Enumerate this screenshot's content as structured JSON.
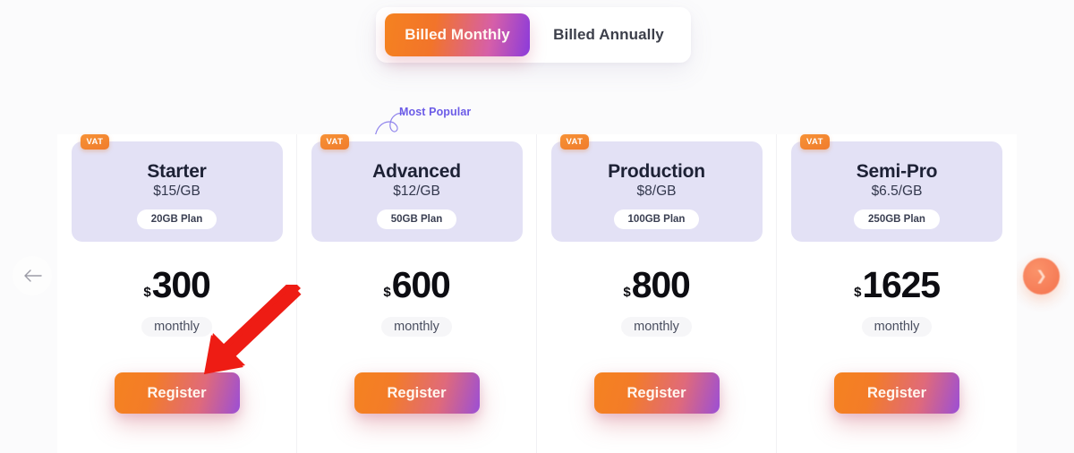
{
  "billing_toggle": {
    "monthly_label": "Billed Monthly",
    "annually_label": "Billed Annually",
    "active": "Billed Monthly",
    "active_gradient_from": "#f58220",
    "active_gradient_to": "#8b3bdb"
  },
  "annotations": {
    "most_popular_label": "Most Popular",
    "most_popular_color": "#6c5ce7",
    "pointer_arrow_color": "#ee1c14",
    "pointer_target": "Register"
  },
  "nav": {
    "prev_icon": "arrow-left-icon",
    "next_icon": "chevron-right-icon",
    "next_color": "#f4693f"
  },
  "plans": [
    {
      "badge": "VAT",
      "name": "Starter",
      "rate": "$15/GB",
      "quota": "20GB Plan",
      "currency": "$",
      "price": "300",
      "period": "monthly",
      "cta": "Register"
    },
    {
      "badge": "VAT",
      "name": "Advanced",
      "rate": "$12/GB",
      "quota": "50GB Plan",
      "currency": "$",
      "price": "600",
      "period": "monthly",
      "cta": "Register"
    },
    {
      "badge": "VAT",
      "name": "Production",
      "rate": "$8/GB",
      "quota": "100GB Plan",
      "currency": "$",
      "price": "800",
      "period": "monthly",
      "cta": "Register"
    },
    {
      "badge": "VAT",
      "name": "Semi-Pro",
      "rate": "$6.5/GB",
      "quota": "250GB Plan",
      "currency": "$",
      "price": "1625",
      "period": "monthly",
      "cta": "Register"
    }
  ]
}
